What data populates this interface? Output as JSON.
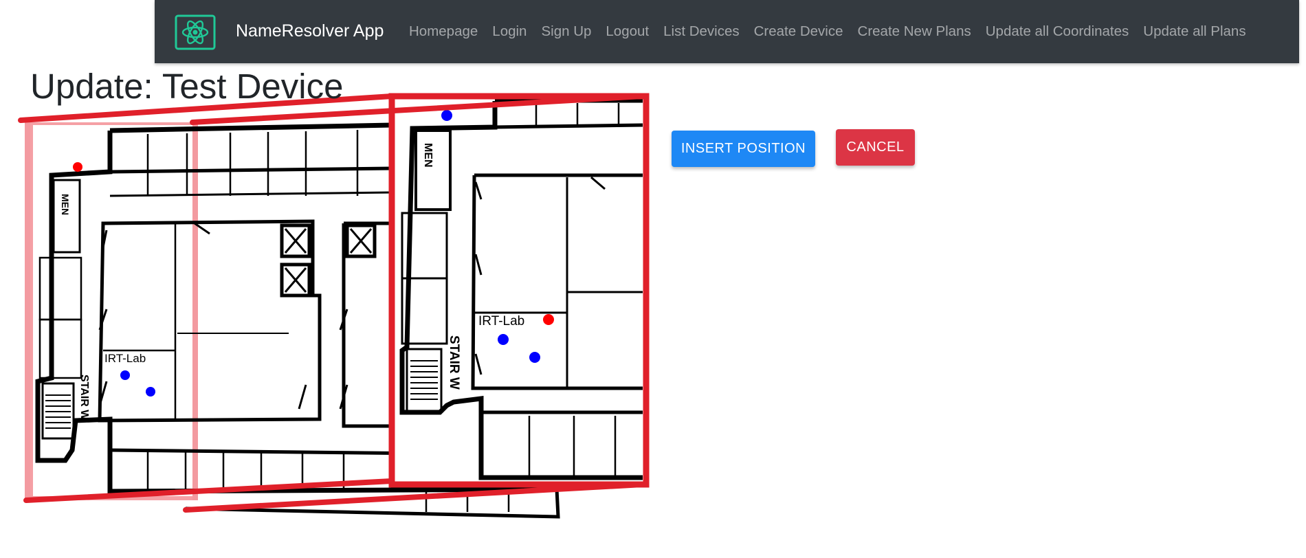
{
  "navbar": {
    "brand": "NameResolver App",
    "links": [
      "Homepage",
      "Login",
      "Sign Up",
      "Logout",
      "List Devices",
      "Create Device",
      "Create New Plans",
      "Update all Coordinates",
      "Update all Plans"
    ]
  },
  "page": {
    "title": "Update: Test Device"
  },
  "plan": {
    "room_label": "IRT-Lab",
    "men_label": "MEN",
    "stair_label": "STAIR W"
  },
  "actions": {
    "insert_label": "INSERT POSITION",
    "cancel_label": "CANCEL"
  },
  "colors": {
    "navbar": "#343a40",
    "insert": "#1e88f5",
    "cancel": "#dc3545",
    "marker_device": "#0000ff",
    "marker_position": "#ff0000",
    "frame": "#e0202a"
  }
}
